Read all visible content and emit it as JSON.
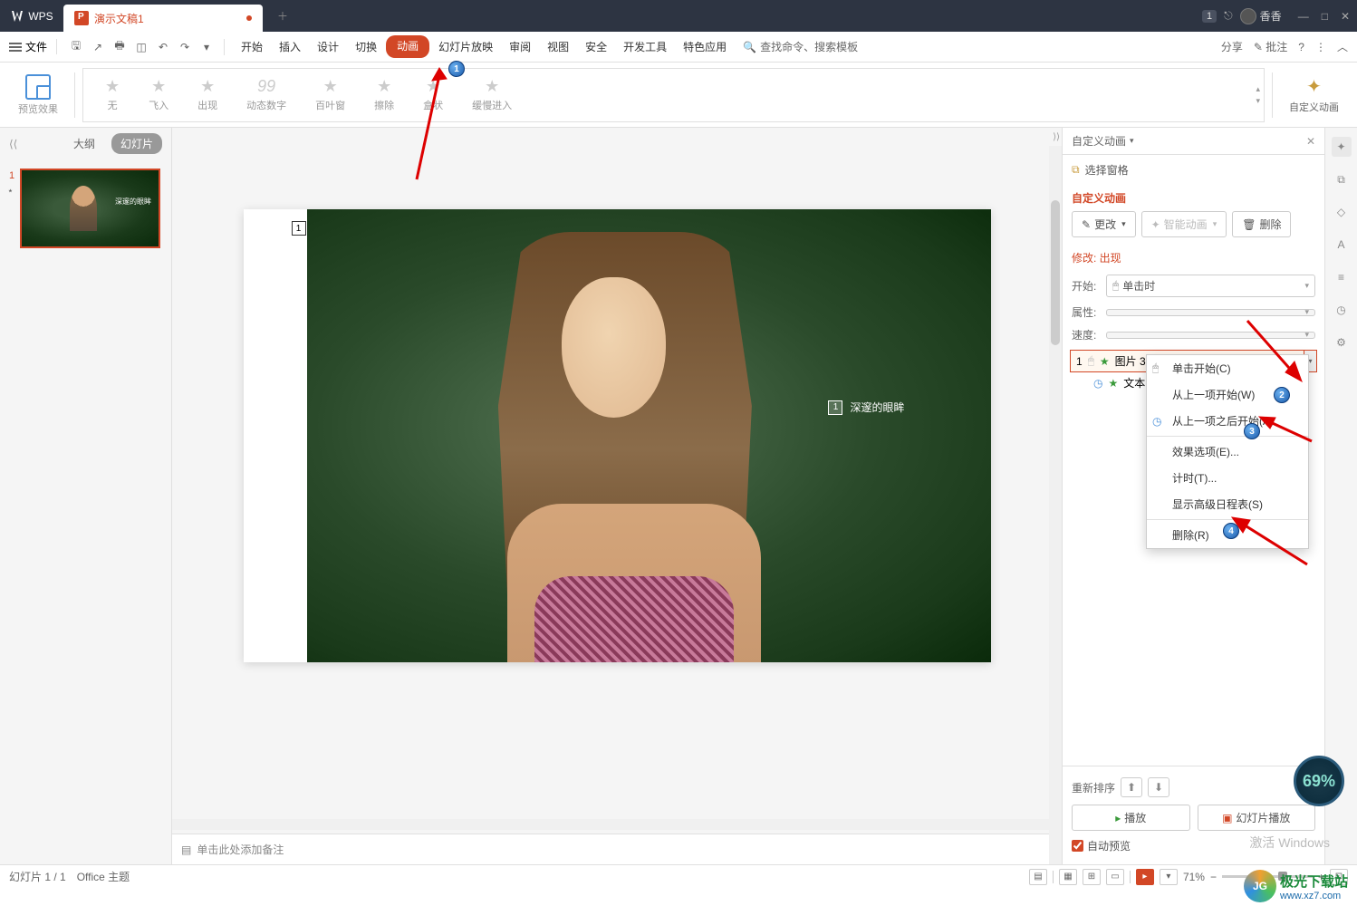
{
  "titlebar": {
    "app": "WPS",
    "tab_title": "演示文稿1",
    "badge": "1",
    "user": "香香"
  },
  "menubar": {
    "file": "文件",
    "items": [
      "开始",
      "插入",
      "设计",
      "切换",
      "动画",
      "幻灯片放映",
      "审阅",
      "视图",
      "安全",
      "开发工具",
      "特色应用"
    ],
    "active_index": 4,
    "search": "查找命令、搜索模板",
    "share": "分享",
    "comment": "批注"
  },
  "ribbon": {
    "preview": "预览效果",
    "anims": [
      "无",
      "飞入",
      "出现",
      "动态数字",
      "百叶窗",
      "擦除",
      "盒状",
      "缓慢进入"
    ],
    "digits_icon": "99",
    "custom": "自定义动画"
  },
  "left": {
    "outline": "大纲",
    "slides": "幻灯片",
    "thumb_text": "深邃的眼眸"
  },
  "slide": {
    "box1": "1",
    "box2": "1",
    "text": "深邃的眼眸"
  },
  "notes": {
    "placeholder": "单击此处添加备注"
  },
  "right": {
    "title": "自定义动画",
    "select_pane": "选择窗格",
    "section": "自定义动画",
    "change": "更改",
    "smart": "智能动画",
    "delete": "删除",
    "modify": "修改: 出现",
    "start_label": "开始:",
    "start_value": "单击时",
    "prop_label": "属性:",
    "speed_label": "速度:",
    "item1_num": "1",
    "item1_text": "图片 3",
    "item2_text": "文本",
    "reorder": "重新排序",
    "play": "播放",
    "slideshow": "幻灯片播放",
    "autopreview": "自动预览"
  },
  "context": {
    "items": [
      "单击开始(C)",
      "从上一项开始(W)",
      "从上一项之后开始(A)",
      "效果选项(E)...",
      "计时(T)...",
      "显示高级日程表(S)",
      "删除(R)"
    ]
  },
  "statusbar": {
    "slide": "幻灯片 1 / 1",
    "theme": "Office 主题",
    "zoom": "71%"
  },
  "watermark": {
    "win": "激活 Windows",
    "brand": "极光下载站",
    "url": "www.xz7.com"
  },
  "countdown": "69%"
}
